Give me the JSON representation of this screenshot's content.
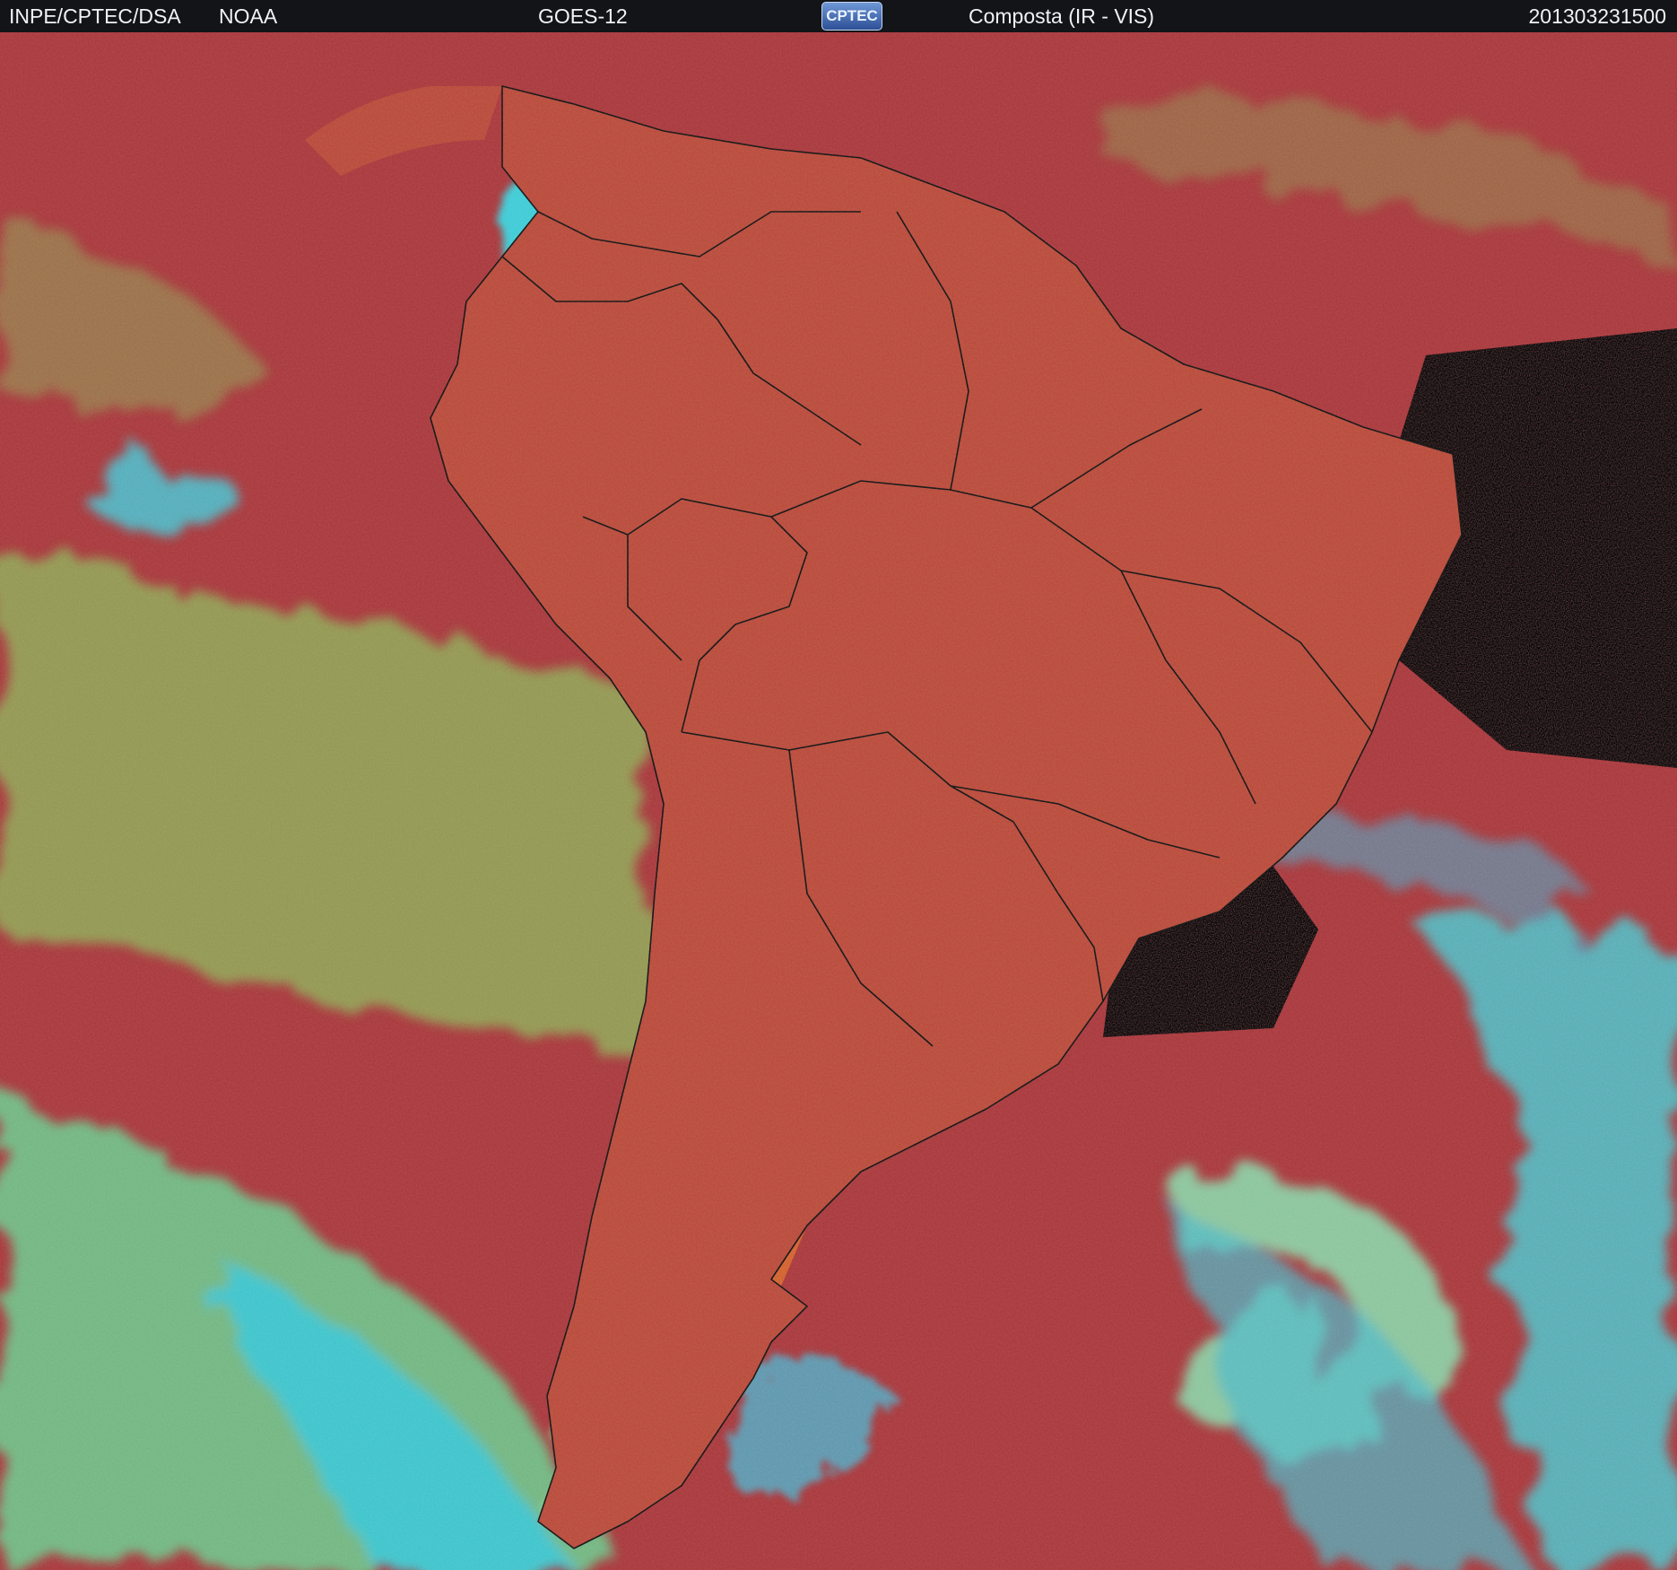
{
  "header": {
    "organization": "INPE/CPTEC/DSA",
    "agency": "NOAA",
    "satellite": "GOES-12",
    "product": "Composta (IR - VIS)",
    "timestamp": "201303231500"
  },
  "logo": {
    "text": "CPTEC"
  },
  "imagery": {
    "description_icon": "satellite-composite-south-america",
    "colors": {
      "clear_ocean": "#a8363a",
      "land_dry": "#c85a30",
      "low_cloud": "#88c85e",
      "high_cloud": "#28d8e8",
      "cold_top": "#b8f0f4",
      "dark_noise": "#1a1516",
      "mid_cloud": "#4a8ac0",
      "border_lines": "#101010"
    }
  }
}
